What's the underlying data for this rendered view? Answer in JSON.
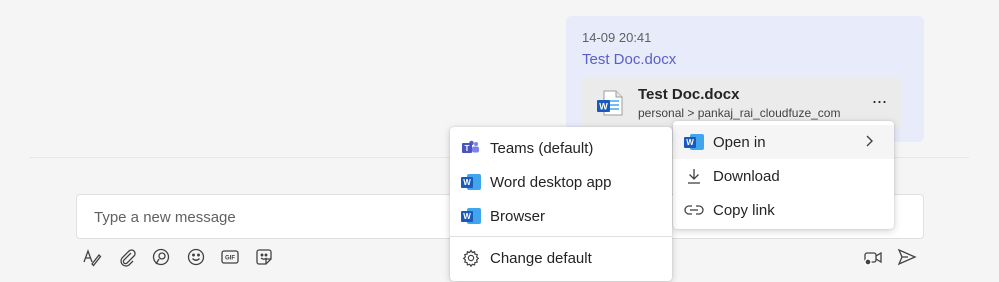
{
  "message": {
    "timestamp": "14-09 20:41",
    "text": "Test Doc.docx",
    "file": {
      "name": "Test Doc.docx",
      "path": "personal > pankaj_rai_cloudfuze_com",
      "more_label": "···",
      "icon": "word-file-icon"
    }
  },
  "compose": {
    "placeholder": "Type a new message"
  },
  "context_menu": {
    "items": [
      {
        "label": "Open in",
        "icon": "word-icon",
        "has_submenu": true
      },
      {
        "label": "Download",
        "icon": "download-icon"
      },
      {
        "label": "Copy link",
        "icon": "link-icon"
      }
    ]
  },
  "open_in_submenu": {
    "items": [
      {
        "label": "Teams (default)",
        "icon": "teams-icon"
      },
      {
        "label": "Word desktop app",
        "icon": "word-icon"
      },
      {
        "label": "Browser",
        "icon": "word-icon"
      },
      {
        "label": "Change default",
        "icon": "gear-icon"
      }
    ]
  },
  "toolbar": {
    "icons": [
      "format-icon",
      "attach-icon",
      "loop-icon",
      "emoji-icon",
      "gif-icon",
      "sticker-icon",
      "meet-now-icon",
      "send-icon"
    ]
  },
  "colors": {
    "accent": "#5b5fc7",
    "bubble": "#e8ebfa",
    "word_blue": "#185abd",
    "teams_purple": "#5b5fc7"
  }
}
